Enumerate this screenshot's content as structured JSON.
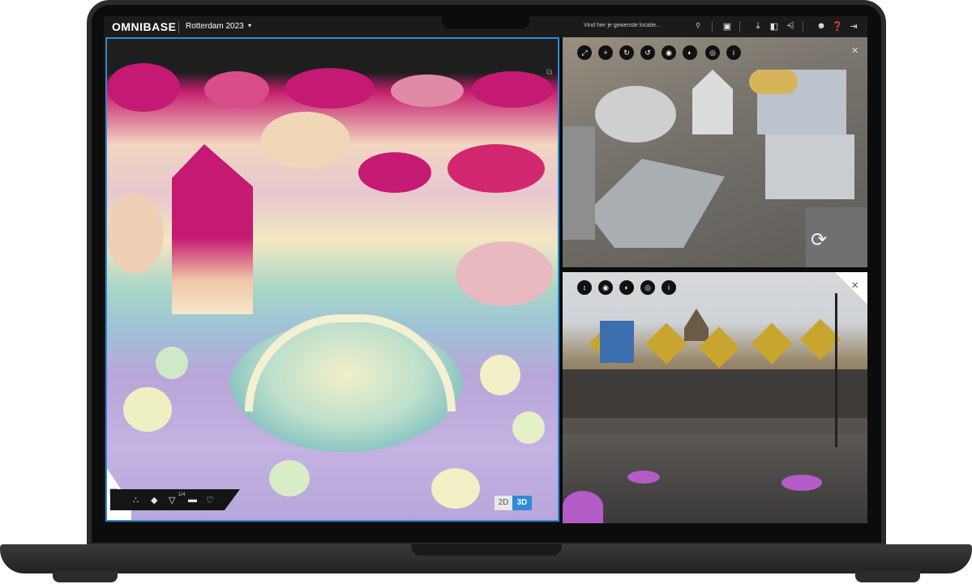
{
  "app": {
    "logo": "OMNIBASE",
    "project": "Rotterdam 2023",
    "project_caret": "▾"
  },
  "topbar": {
    "search_placeholder": "Vind hier je gewenste locatie...",
    "icons": [
      "search-icon",
      "save-icon",
      "download-icon",
      "export-icon",
      "share-icon",
      "users-icon",
      "help-icon",
      "logout-icon"
    ]
  },
  "left_pane": {
    "view_2d": "2D",
    "view_3d": "3D",
    "filter_count": "1/4",
    "tools": [
      "points-icon",
      "layers-icon",
      "filter-icon",
      "measure-icon",
      "ear-icon"
    ]
  },
  "oblique_pane": {
    "controls": [
      "fullscreen-icon",
      "crosshair-icon",
      "rotate-right-icon",
      "rotate-left-icon",
      "eye-icon",
      "contrast-icon",
      "target-icon",
      "info-icon"
    ]
  },
  "street_pane": {
    "controls": [
      "vertical-arrows-icon",
      "eye-icon",
      "contrast-icon",
      "target-icon",
      "info-icon"
    ]
  },
  "colors": {
    "accent": "#2f8ad6",
    "magenta": "#c41a73"
  }
}
